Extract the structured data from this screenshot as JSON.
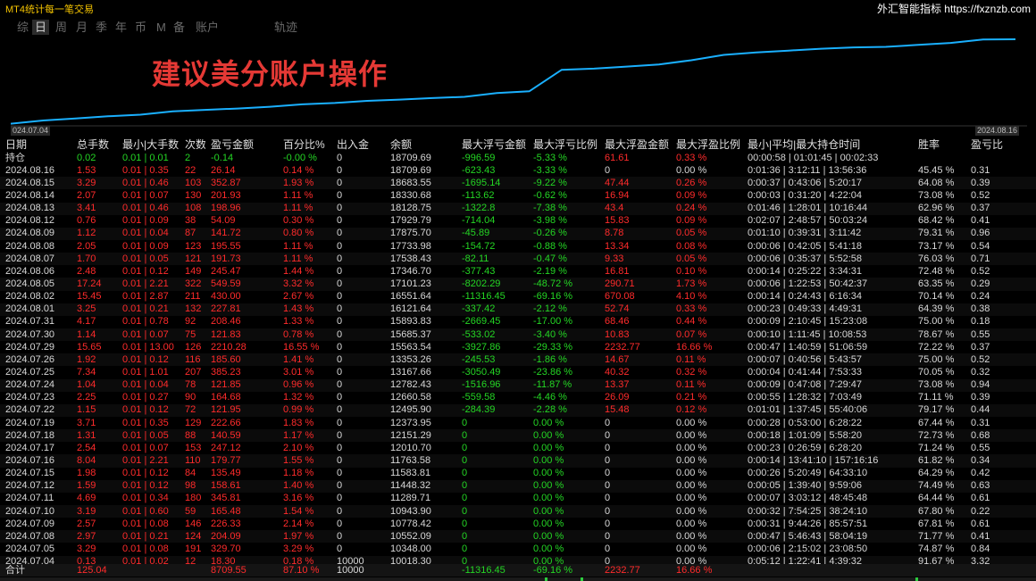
{
  "app_title": "MT4统计每一笔交易",
  "brand": "外汇智能指标 https://fxznzb.com",
  "tabs": [
    "综",
    "日",
    "周",
    "月",
    "季",
    "年",
    "币",
    "M",
    "备",
    "账户",
    "轨迹"
  ],
  "active_tab": 1,
  "watermark": "建议美分账户操作",
  "chart": {
    "start_label": "024.07.04",
    "end_label": "2024.08.16",
    "line_color": "#1ab0ff",
    "balance": [
      10018.3,
      10348.0,
      10552.09,
      10778.42,
      10943.9,
      11289.71,
      11448.32,
      11583.81,
      11763.58,
      12010.7,
      12151.29,
      12373.95,
      12495.9,
      12660.58,
      12782.43,
      13167.66,
      13353.26,
      15563.54,
      15685.37,
      15893.83,
      16121.64,
      16551.64,
      17101.23,
      17346.7,
      17538.43,
      17733.98,
      17875.7,
      17929.79,
      18128.75,
      18330.68,
      18683.55,
      18709.69
    ]
  },
  "headers": [
    "日期",
    "总手数",
    "最小|大手数",
    "次数",
    "盈亏金额",
    "百分比%",
    "出入金",
    "余额",
    "最大浮亏金额",
    "最大浮亏比例",
    "最大浮盈金额",
    "最大浮盈比例",
    "最小|平均|最大持仓时间",
    "胜率",
    "盈亏比"
  ],
  "position_row": [
    "持仓",
    "0.02",
    "0.01 | 0.01",
    "2",
    "-0.14",
    "-0.00 %",
    "0",
    "18709.69",
    "-996.59",
    "-5.33 %",
    "61.61",
    "0.33 %",
    "00:00:58 | 01:01:45 | 00:02:33",
    "",
    ""
  ],
  "rows": [
    [
      "2024.08.16",
      "1.53",
      "0.01 | 0.35",
      "22",
      "26.14",
      "0.14 %",
      "0",
      "18709.69",
      "-623.43",
      "-3.33 %",
      "0",
      "0.00 %",
      "0:01:36 | 3:12:11 | 13:56:36",
      "45.45 %",
      "0.31"
    ],
    [
      "2024.08.15",
      "3.29",
      "0.01 | 0.46",
      "103",
      "352.87",
      "1.93 %",
      "0",
      "18683.55",
      "-1695.14",
      "-9.22 %",
      "47.44",
      "0.26 %",
      "0:00:37 | 0:43:06 | 5:20:17",
      "64.08 %",
      "0.39"
    ],
    [
      "2024.08.14",
      "2.07",
      "0.01 | 0.07",
      "130",
      "201.93",
      "1.11 %",
      "0",
      "18330.68",
      "-113.62",
      "-0.62 %",
      "16.94",
      "0.09 %",
      "0:00:03 | 0:31:20 | 4:22:04",
      "73.08 %",
      "0.52"
    ],
    [
      "2024.08.13",
      "3.41",
      "0.01 | 0.46",
      "108",
      "198.96",
      "1.11 %",
      "0",
      "18128.75",
      "-1322.8",
      "-7.38 %",
      "43.4",
      "0.24 %",
      "0:01:46 | 1:28:01 | 10:16:44",
      "62.96 %",
      "0.37"
    ],
    [
      "2024.08.12",
      "0.76",
      "0.01 | 0.09",
      "38",
      "54.09",
      "0.30 %",
      "0",
      "17929.79",
      "-714.04",
      "-3.98 %",
      "15.83",
      "0.09 %",
      "0:02:07 | 2:48:57 | 50:03:24",
      "68.42 %",
      "0.41"
    ],
    [
      "2024.08.09",
      "1.12",
      "0.01 | 0.04",
      "87",
      "141.72",
      "0.80 %",
      "0",
      "17875.70",
      "-45.89",
      "-0.26 %",
      "8.78",
      "0.05 %",
      "0:01:10 | 0:39:31 | 3:11:42",
      "79.31 %",
      "0.96"
    ],
    [
      "2024.08.08",
      "2.05",
      "0.01 | 0.09",
      "123",
      "195.55",
      "1.11 %",
      "0",
      "17733.98",
      "-154.72",
      "-0.88 %",
      "13.34",
      "0.08 %",
      "0:00:06 | 0:42:05 | 5:41:18",
      "73.17 %",
      "0.54"
    ],
    [
      "2024.08.07",
      "1.70",
      "0.01 | 0.05",
      "121",
      "191.73",
      "1.11 %",
      "0",
      "17538.43",
      "-82.11",
      "-0.47 %",
      "9.33",
      "0.05 %",
      "0:00:06 | 0:35:37 | 5:52:58",
      "76.03 %",
      "0.71"
    ],
    [
      "2024.08.06",
      "2.48",
      "0.01 | 0.12",
      "149",
      "245.47",
      "1.44 %",
      "0",
      "17346.70",
      "-377.43",
      "-2.19 %",
      "16.81",
      "0.10 %",
      "0:00:14 | 0:25:22 | 3:34:31",
      "72.48 %",
      "0.52"
    ],
    [
      "2024.08.05",
      "17.24",
      "0.01 | 2.21",
      "322",
      "549.59",
      "3.32 %",
      "0",
      "17101.23",
      "-8202.29",
      "-48.72 %",
      "290.71",
      "1.73 %",
      "0:00:06 | 1:22:53 | 50:42:37",
      "63.35 %",
      "0.29"
    ],
    [
      "2024.08.02",
      "15.45",
      "0.01 | 2.87",
      "211",
      "430.00",
      "2.67 %",
      "0",
      "16551.64",
      "-11316.45",
      "-69.16 %",
      "670.08",
      "4.10 %",
      "0:00:14 | 0:24:43 | 6:16:34",
      "70.14 %",
      "0.24"
    ],
    [
      "2024.08.01",
      "3.25",
      "0.01 | 0.21",
      "132",
      "227.81",
      "1.43 %",
      "0",
      "16121.64",
      "-337.42",
      "-2.12 %",
      "52.74",
      "0.33 %",
      "0:00:23 | 0:49:33 | 4:49:31",
      "64.39 %",
      "0.38"
    ],
    [
      "2024.07.31",
      "4.17",
      "0.01 | 0.78",
      "92",
      "208.46",
      "1.33 %",
      "0",
      "15893.83",
      "-2669.45",
      "-17.00 %",
      "68.46",
      "0.44 %",
      "0:00:09 | 2:10:45 | 15:23:08",
      "75.00 %",
      "0.18"
    ],
    [
      "2024.07.30",
      "1.14",
      "0.01 | 0.07",
      "75",
      "121.83",
      "0.78 %",
      "0",
      "15685.37",
      "-533.02",
      "-3.40 %",
      "10.83",
      "0.07 %",
      "0:00:10 | 1:11:45 | 10:08:53",
      "78.67 %",
      "0.55"
    ],
    [
      "2024.07.29",
      "15.65",
      "0.01 | 13.00",
      "126",
      "2210.28",
      "16.55 %",
      "0",
      "15563.54",
      "-3927.86",
      "-29.33 %",
      "2232.77",
      "16.66 %",
      "0:00:47 | 1:40:59 | 51:06:59",
      "72.22 %",
      "0.37"
    ],
    [
      "2024.07.26",
      "1.92",
      "0.01 | 0.12",
      "116",
      "185.60",
      "1.41 %",
      "0",
      "13353.26",
      "-245.53",
      "-1.86 %",
      "14.67",
      "0.11 %",
      "0:00:07 | 0:40:56 | 5:43:57",
      "75.00 %",
      "0.52"
    ],
    [
      "2024.07.25",
      "7.34",
      "0.01 | 1.01",
      "207",
      "385.23",
      "3.01 %",
      "0",
      "13167.66",
      "-3050.49",
      "-23.86 %",
      "40.32",
      "0.32 %",
      "0:00:04 | 0:41:44 | 7:53:33",
      "70.05 %",
      "0.32"
    ],
    [
      "2024.07.24",
      "1.04",
      "0.01 | 0.04",
      "78",
      "121.85",
      "0.96 %",
      "0",
      "12782.43",
      "-1516.96",
      "-11.87 %",
      "13.37",
      "0.11 %",
      "0:00:09 | 0:47:08 | 7:29:47",
      "73.08 %",
      "0.94"
    ],
    [
      "2024.07.23",
      "2.25",
      "0.01 | 0.27",
      "90",
      "164.68",
      "1.32 %",
      "0",
      "12660.58",
      "-559.58",
      "-4.46 %",
      "26.09",
      "0.21 %",
      "0:00:55 | 1:28:32 | 7:03:49",
      "71.11 %",
      "0.39"
    ],
    [
      "2024.07.22",
      "1.15",
      "0.01 | 0.12",
      "72",
      "121.95",
      "0.99 %",
      "0",
      "12495.90",
      "-284.39",
      "-2.28 %",
      "15.48",
      "0.12 %",
      "0:01:01 | 1:37:45 | 55:40:06",
      "79.17 %",
      "0.44"
    ],
    [
      "2024.07.19",
      "3.71",
      "0.01 | 0.35",
      "129",
      "222.66",
      "1.83 %",
      "0",
      "12373.95",
      "0",
      "0.00 %",
      "0",
      "0.00 %",
      "0:00:28 | 0:53:00 | 6:28:22",
      "67.44 %",
      "0.31"
    ],
    [
      "2024.07.18",
      "1.31",
      "0.01 | 0.05",
      "88",
      "140.59",
      "1.17 %",
      "0",
      "12151.29",
      "0",
      "0.00 %",
      "0",
      "0.00 %",
      "0:00:18 | 1:01:09 | 5:58:20",
      "72.73 %",
      "0.68"
    ],
    [
      "2024.07.17",
      "2.54",
      "0.01 | 0.07",
      "153",
      "247.12",
      "2.10 %",
      "0",
      "12010.70",
      "0",
      "0.00 %",
      "0",
      "0.00 %",
      "0:00:23 | 0:26:59 | 6:28:20",
      "71.24 %",
      "0.55"
    ],
    [
      "2024.07.16",
      "8.04",
      "0.01 | 2.21",
      "110",
      "179.77",
      "1.55 %",
      "0",
      "11763.58",
      "0",
      "0.00 %",
      "0",
      "0.00 %",
      "0:00:14 | 13:41:10 | 157:16:16",
      "61.82 %",
      "0.34"
    ],
    [
      "2024.07.15",
      "1.98",
      "0.01 | 0.12",
      "84",
      "135.49",
      "1.18 %",
      "0",
      "11583.81",
      "0",
      "0.00 %",
      "0",
      "0.00 %",
      "0:00:26 | 5:20:49 | 64:33:10",
      "64.29 %",
      "0.42"
    ],
    [
      "2024.07.12",
      "1.59",
      "0.01 | 0.12",
      "98",
      "158.61",
      "1.40 %",
      "0",
      "11448.32",
      "0",
      "0.00 %",
      "0",
      "0.00 %",
      "0:00:05 | 1:39:40 | 9:59:06",
      "74.49 %",
      "0.63"
    ],
    [
      "2024.07.11",
      "4.69",
      "0.01 | 0.34",
      "180",
      "345.81",
      "3.16 %",
      "0",
      "11289.71",
      "0",
      "0.00 %",
      "0",
      "0.00 %",
      "0:00:07 | 3:03:12 | 48:45:48",
      "64.44 %",
      "0.61"
    ],
    [
      "2024.07.10",
      "3.19",
      "0.01 | 0.60",
      "59",
      "165.48",
      "1.54 %",
      "0",
      "10943.90",
      "0",
      "0.00 %",
      "0",
      "0.00 %",
      "0:00:32 | 7:54:25 | 38:24:10",
      "67.80 %",
      "0.22"
    ],
    [
      "2024.07.09",
      "2.57",
      "0.01 | 0.08",
      "146",
      "226.33",
      "2.14 %",
      "0",
      "10778.42",
      "0",
      "0.00 %",
      "0",
      "0.00 %",
      "0:00:31 | 9:44:26 | 85:57:51",
      "67.81 %",
      "0.61"
    ],
    [
      "2024.07.08",
      "2.97",
      "0.01 | 0.21",
      "124",
      "204.09",
      "1.97 %",
      "0",
      "10552.09",
      "0",
      "0.00 %",
      "0",
      "0.00 %",
      "0:00:47 | 5:46:43 | 58:04:19",
      "71.77 %",
      "0.41"
    ],
    [
      "2024.07.05",
      "3.29",
      "0.01 | 0.08",
      "191",
      "329.70",
      "3.29 %",
      "0",
      "10348.00",
      "0",
      "0.00 %",
      "0",
      "0.00 %",
      "0:00:06 | 2:15:02 | 23:08:50",
      "74.87 %",
      "0.84"
    ],
    [
      "2024.07.04",
      "0.13",
      "0.01 | 0.02",
      "12",
      "18.30",
      "0.18 %",
      "10000",
      "10018.30",
      "0",
      "0.00 %",
      "0",
      "0.00 %",
      "0:05:12 | 1:22:41 | 4:39:32",
      "91.67 %",
      "3.32"
    ]
  ],
  "total_row": [
    "合计",
    "125.04",
    "",
    "",
    "8709.55",
    "87.10 %",
    "10000",
    "",
    "-11316.45",
    "-69.16 %",
    "2232.77",
    "16.66 %",
    "",
    "",
    ""
  ]
}
